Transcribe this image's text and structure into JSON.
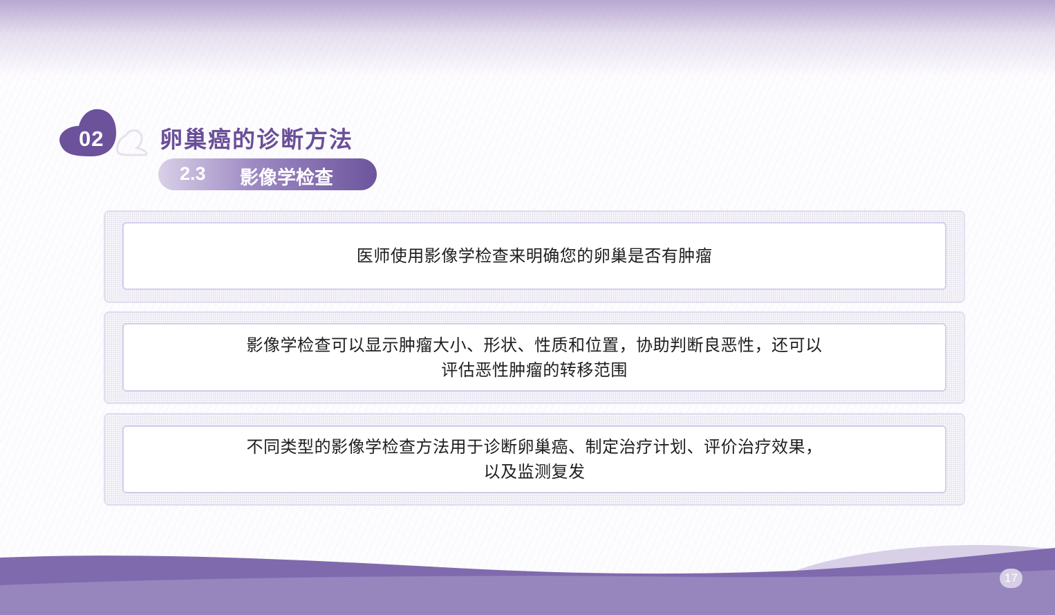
{
  "section": {
    "number": "02",
    "title": "卵巢癌的诊断方法"
  },
  "subsection": {
    "number": "2.3",
    "title": "影像学检查"
  },
  "cards": [
    {
      "text": "医师使用影像学检查来明确您的卵巢是否有肿瘤"
    },
    {
      "line1": "影像学检查可以显示肿瘤大小、形状、性质和位置，协助判断良恶性，还可以",
      "line2": "评估恶性肿瘤的转移范围"
    },
    {
      "line1": "不同类型的影像学检查方法用于诊断卵巢癌、制定治疗计划、评价治疗效果，",
      "line2": "以及监测复发"
    }
  ],
  "page_number": "17",
  "colors": {
    "accent": "#6a4f98",
    "band": "#7f6aae",
    "card_border": "#d5ceea"
  }
}
